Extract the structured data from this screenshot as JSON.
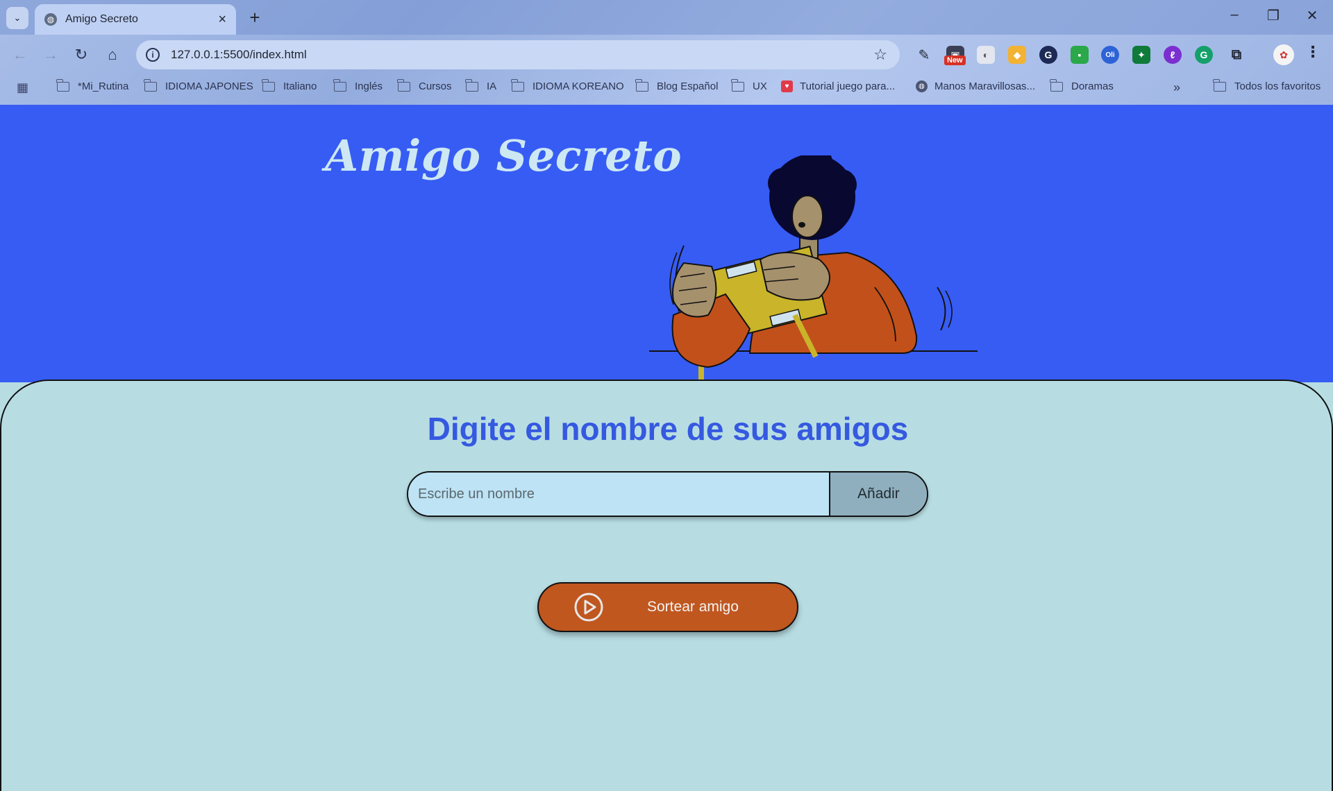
{
  "browser": {
    "tab_title": "Amigo Secreto",
    "url": "127.0.0.1:5500/index.html",
    "new_badge": "New",
    "bookmarks": [
      {
        "label": "*Mi_Rutina",
        "type": "folder"
      },
      {
        "label": "IDIOMA JAPONES",
        "type": "folder"
      },
      {
        "label": "Italiano",
        "type": "folder"
      },
      {
        "label": "Inglés",
        "type": "folder"
      },
      {
        "label": "Cursos",
        "type": "folder"
      },
      {
        "label": "IA",
        "type": "folder"
      },
      {
        "label": "IDIOMA KOREANO",
        "type": "folder"
      },
      {
        "label": "Blog Español",
        "type": "folder"
      },
      {
        "label": "UX",
        "type": "folder"
      },
      {
        "label": "Tutorial juego para...",
        "type": "site"
      },
      {
        "label": "Manos Maravillosas...",
        "type": "site"
      },
      {
        "label": "Doramas",
        "type": "folder"
      }
    ],
    "all_bookmarks": "Todos los favoritos",
    "overflow": "»"
  },
  "page": {
    "title": "Amigo Secreto",
    "subtitle": "Digite el nombre de sus amigos",
    "input_placeholder": "Escribe un nombre",
    "add_label": "Añadir",
    "draw_label": "Sortear amigo"
  },
  "colors": {
    "header_bg": "#375cf4",
    "section_bg": "#b7dde3",
    "title": "#cde8f2",
    "subtitle": "#3559e0",
    "draw_button": "#c0571f",
    "add_button": "#8fafbe"
  }
}
